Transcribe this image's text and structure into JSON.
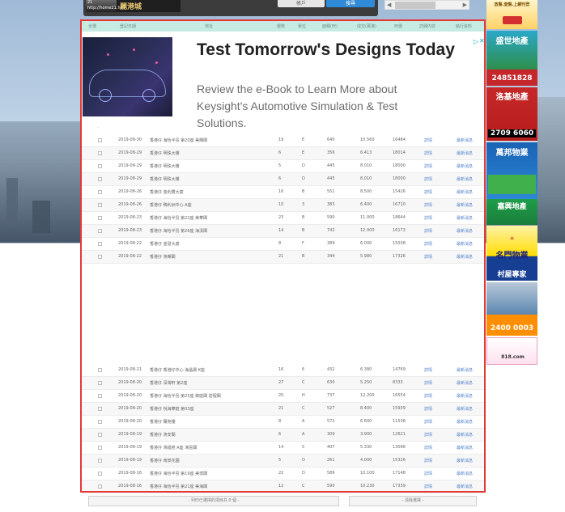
{
  "topbar": {
    "logo_badge": "21",
    "logo_url": "http://home21.hk",
    "logo_text": "麗港城",
    "btn_left": "帳戶",
    "btn_right": "搜尋"
  },
  "table": {
    "headers": [
      "全選",
      "登記日期",
      "地址",
      "層數",
      "單位",
      "面積(呎)",
      "成交(萬港)",
      "呎價",
      "詳細內容",
      "執行資料"
    ],
    "rows_top": [
      {
        "date": "2019-08-30",
        "building": "香港仔 海怡半島 第20座 美輝閣",
        "floor": "19",
        "unit": "E",
        "area": "640",
        "price": "10.560",
        "unit_price": "16484",
        "link": "詳情",
        "mark": "最新消息"
      },
      {
        "date": "2019-08-29",
        "building": "香港仔 明珠大樓",
        "floor": "6",
        "unit": "E",
        "area": "356",
        "price": "6.413",
        "unit_price": "18014",
        "link": "詳情",
        "mark": "最新消息"
      },
      {
        "date": "2019-08-29",
        "building": "香港仔 明珠大樓",
        "floor": "5",
        "unit": "D",
        "area": "445",
        "price": "8.010",
        "unit_price": "18000",
        "link": "詳情",
        "mark": "最新消息"
      },
      {
        "date": "2019-08-29",
        "building": "香港仔 明珠大樓",
        "floor": "6",
        "unit": "D",
        "area": "445",
        "price": "8.010",
        "unit_price": "18000",
        "link": "詳情",
        "mark": "最新消息"
      },
      {
        "date": "2019-08-26",
        "building": "香港仔 金利豐大廈",
        "floor": "16",
        "unit": "B",
        "area": "551",
        "price": "8.500",
        "unit_price": "15426",
        "link": "詳情",
        "mark": "最新消息"
      },
      {
        "date": "2019-08-26",
        "building": "香港仔 鴨利洲中心 A座",
        "floor": "10",
        "unit": "3",
        "area": "383",
        "price": "6.400",
        "unit_price": "16710",
        "link": "詳情",
        "mark": "最新消息"
      },
      {
        "date": "2019-08-23",
        "building": "香港仔 海怡半島 第22座 美華閣",
        "floor": "23",
        "unit": "B",
        "area": "590",
        "price": "11.000",
        "unit_price": "18644",
        "link": "詳情",
        "mark": "最新消息"
      },
      {
        "date": "2019-08-23",
        "building": "香港仔 海怡半島 第26座 海潔閣",
        "floor": "14",
        "unit": "B",
        "area": "742",
        "price": "12.000",
        "unit_price": "16173",
        "link": "詳情",
        "mark": "最新消息"
      },
      {
        "date": "2019-08-22",
        "building": "香港仔 金發大廈",
        "floor": "8",
        "unit": "F",
        "area": "389",
        "price": "6.000",
        "unit_price": "15038",
        "link": "詳情",
        "mark": "最新消息"
      },
      {
        "date": "2019-08-22",
        "building": "香港仔 漁暉閣",
        "floor": "21",
        "unit": "B",
        "area": "344",
        "price": "5.980",
        "unit_price": "17326",
        "link": "詳情",
        "mark": "最新消息"
      }
    ],
    "rows_bottom": [
      {
        "date": "2019-08-21",
        "building": "香港仔 香港仔中心 海晶閣 K座",
        "floor": "16",
        "unit": "6",
        "area": "432",
        "price": "6.380",
        "unit_price": "14769",
        "link": "詳情",
        "mark": "最新消息"
      },
      {
        "date": "2019-08-20",
        "building": "香港仔 深灣軒 第2座",
        "floor": "27",
        "unit": "C",
        "area": "630",
        "price": "5.250",
        "unit_price": "8333",
        "link": "詳情",
        "mark": "最新消息"
      },
      {
        "date": "2019-08-20",
        "building": "香港仔 海怡半島 第25座 御庭閣 碧程閣",
        "floor": "20",
        "unit": "H",
        "area": "737",
        "price": "12.200",
        "unit_price": "16554",
        "link": "詳情",
        "mark": "最新消息"
      },
      {
        "date": "2019-08-20",
        "building": "香港仔 悅海華庭 第03座",
        "floor": "21",
        "unit": "C",
        "area": "527",
        "price": "8.400",
        "unit_price": "15939",
        "link": "詳情",
        "mark": "最新消息"
      },
      {
        "date": "2019-08-20",
        "building": "香港仔 蘭苑樓",
        "floor": "8",
        "unit": "A",
        "area": "572",
        "price": "6.600",
        "unit_price": "11538",
        "link": "詳情",
        "mark": "最新消息"
      },
      {
        "date": "2019-08-19",
        "building": "香港仔 漁安閣",
        "floor": "6",
        "unit": "A",
        "area": "309",
        "price": "3.900",
        "unit_price": "12621",
        "link": "詳情",
        "mark": "最新消息"
      },
      {
        "date": "2019-08-19",
        "building": "香港仔 鴻福苑 A座 鴻喜閣",
        "floor": "14",
        "unit": "5",
        "area": "407",
        "price": "5.330",
        "unit_price": "13096",
        "link": "詳情",
        "mark": "最新消息"
      },
      {
        "date": "2019-08-19",
        "building": "香港仔 南景花園",
        "floor": "5",
        "unit": "D",
        "area": "261",
        "price": "4.000",
        "unit_price": "15326",
        "link": "詳情",
        "mark": "最新消息"
      },
      {
        "date": "2019-08-16",
        "building": "香港仔 海怡半島 第19座 美璟閣",
        "floor": "22",
        "unit": "D",
        "area": "589",
        "price": "10.100",
        "unit_price": "17148",
        "link": "詳情",
        "mark": "最新消息"
      },
      {
        "date": "2019-08-16",
        "building": "香港仔 海怡半島 第21座 美海閣",
        "floor": "12",
        "unit": "C",
        "area": "590",
        "price": "10.230",
        "unit_price": "17339",
        "link": "詳情",
        "mark": "最新消息"
      }
    ]
  },
  "ad": {
    "title": "Test Tomorrow's Designs Today",
    "description": "Review the e-Book to Learn More about Keysight's Automotive Simulation & Test Solutions.",
    "choices": "▷",
    "close": "✕",
    "dot": "·"
  },
  "bottom": {
    "left_btn": "- 列印已選擇的項目共 0 個 -",
    "right_btn": "- 清除選擇 -"
  },
  "sidebar": {
    "s0": "放盤.查盤.上網刊登",
    "s1_name": "盛世地產",
    "s1_phone": "24851828",
    "s2_name": "洛基地產",
    "s2_phone": "2709 6060",
    "s3_name": "萬邦物業",
    "s4_name": "嘉興地產",
    "s5_name": "名門物業",
    "s5_sub": "村屋專家",
    "s6_phone": "2400 0003",
    "s7": "818.com"
  }
}
